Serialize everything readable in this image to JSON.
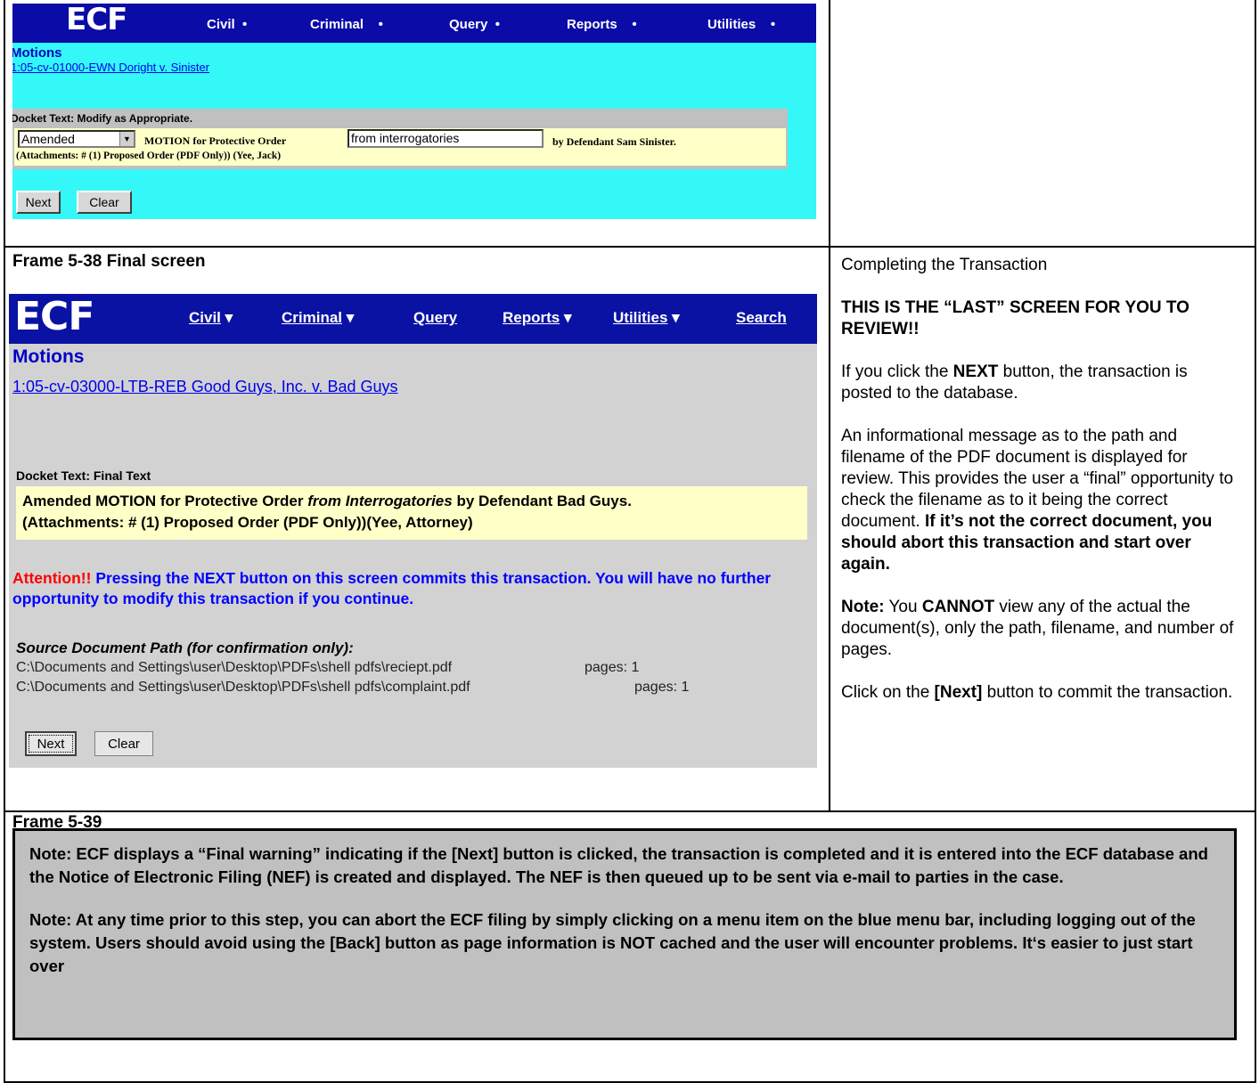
{
  "screen1": {
    "logo": "ECF",
    "menu": [
      "Civil",
      "Criminal",
      "Query",
      "Reports",
      "Utilities"
    ],
    "page_title": "Motions",
    "case_link": "1:05-cv-01000-EWN Doright v. Sinister",
    "docket_label": "Docket Text: Modify as Appropriate.",
    "select_value": "Amended",
    "motion_text": "MOTION for Protective Order",
    "input_value": "from interrogatories",
    "by_text": "by Defendant Sam Sinister.",
    "attachments": "(Attachments: # (1) Proposed Order (PDF Only)) (Yee, Jack)",
    "next_label": "Next",
    "clear_label": "Clear"
  },
  "frame538": {
    "label": "Frame 5-38 Final screen",
    "heading": "Completing the Transaction",
    "last_screen": "THIS IS THE “LAST” SCREEN FOR YOU TO REVIEW!!",
    "p1_a": "If you click the ",
    "p1_b": "NEXT",
    "p1_c": " button, the transaction is posted to the database.",
    "p2_a": "An informational message as to the path and filename of the PDF document is displayed for review.  This provides the user a “final” opportunity to check the filename as to it being the correct document.  ",
    "p2_b": "If it’s not the correct document, you should abort this transaction and start over again.",
    "p3_a": "Note:",
    "p3_b": " You ",
    "p3_c": "CANNOT",
    "p3_d": " view any of the actual the document(s), only the path, filename, and number of pages.",
    "p4_a": "Click on the ",
    "p4_b": "[Next]",
    "p4_c": " button to commit the transaction."
  },
  "screen2": {
    "logo": "ECF",
    "menu_civil": "Civil",
    "menu_criminal": "Criminal",
    "menu_query": "Query",
    "menu_reports": "Reports",
    "menu_utilities": "Utilities",
    "menu_search": "Search",
    "page_title": "Motions",
    "case_link": "1:05-cv-03000-LTB-REB Good Guys, Inc. v. Bad Guys",
    "docket_label": "Docket Text: Final Text",
    "final_a": "Amended MOTION for Protective Order ",
    "final_b": "from Interrogatories",
    "final_c": " by Defendant Bad Guys.",
    "final_line2": "(Attachments: # (1) Proposed Order (PDF Only))(Yee, Attorney)",
    "attention": "Attention!!",
    "warning": " Pressing the NEXT button on this screen commits this transaction. You will have no further opportunity to modify this transaction if you continue.",
    "source_label": "Source Document Path (for confirmation only):",
    "path1": "C:\\Documents and Settings\\user\\Desktop\\PDFs\\shell pdfs\\reciept.pdf",
    "pages1": "pages: 1",
    "path2": "C:\\Documents and Settings\\user\\Desktop\\PDFs\\shell pdfs\\complaint.pdf",
    "pages2": "pages: 1",
    "next_label": "Next",
    "clear_label": "Clear"
  },
  "frame539": {
    "label": "Frame 5-39",
    "note1": "Note: ECF displays a “Final warning” indicating if the [Next] button is clicked, the transaction is completed and it is entered into the ECF database and the Notice of Electronic Filing (NEF) is created and displayed.  The NEF is then queued up to be sent via e-mail to parties in the case.",
    "note2": "Note: At any time prior to this step, you can abort the ECF filing by simply clicking on a menu item on the blue menu bar, including logging out of the system.  Users should avoid using the [Back] button as page information is NOT cached and the user will encounter problems.  It‘s easier to just start over"
  },
  "colors": {
    "navbar": "#0b0ba8",
    "screen1_bg": "#34f7f7",
    "screen2_bg": "#d2d2d2",
    "docket_bg": "#ffffc8",
    "attention": "#ff0000",
    "warning": "#0000ff"
  }
}
